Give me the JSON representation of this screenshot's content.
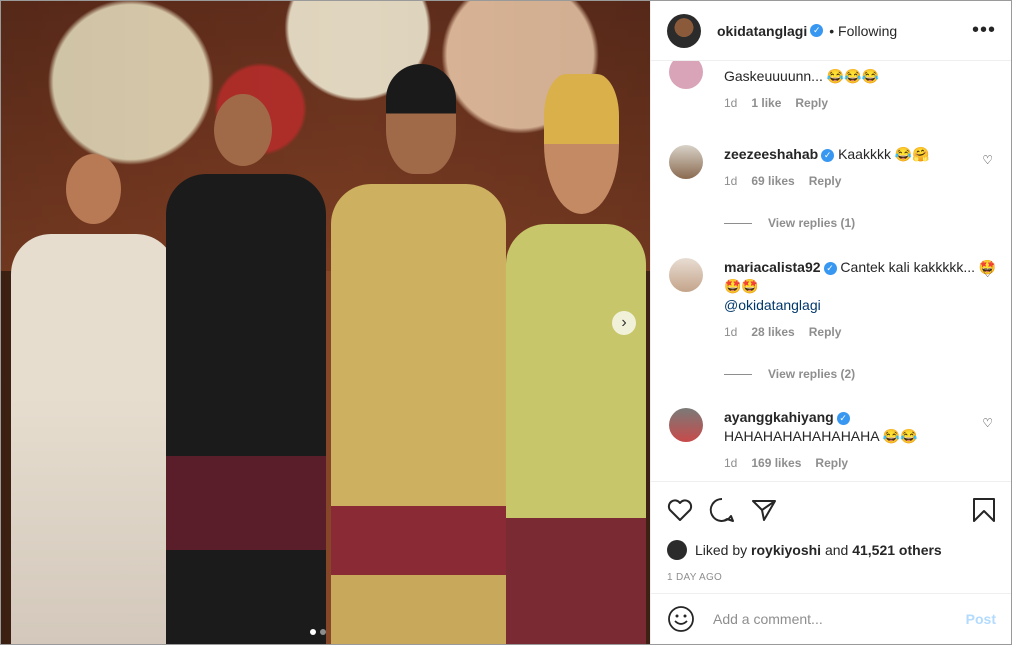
{
  "post": {
    "username": "okidatanglagi",
    "follow_status": "Following",
    "more_label": "•••"
  },
  "comments": [
    {
      "username": "",
      "text": "Gaskeuuuunn... 😂😂😂",
      "time": "1d",
      "likes": "1 like",
      "reply": "Reply"
    },
    {
      "username": "zeezeeshahab",
      "verified": true,
      "text": "Kaakkkk 😂🤗",
      "time": "1d",
      "likes": "69 likes",
      "reply": "Reply",
      "view_replies": "View replies (1)"
    },
    {
      "username": "mariacalista92",
      "verified": true,
      "text": "Cantek kali kakkkkk... 🤩🤩🤩",
      "mention": "@okidatanglagi",
      "time": "1d",
      "likes": "28 likes",
      "reply": "Reply",
      "view_replies": "View replies (2)"
    },
    {
      "username": "ayanggkahiyang",
      "verified": true,
      "text": "HAHAHAHAHAHAHAHA 😂😂",
      "time": "1d",
      "likes": "169 likes",
      "reply": "Reply"
    }
  ],
  "likes": {
    "prefix": "Liked by",
    "user": "roykiyoshi",
    "and": "and",
    "others": "41,521 others"
  },
  "timestamp": "1 DAY AGO",
  "add_comment": {
    "placeholder": "Add a comment...",
    "post_label": "Post"
  },
  "carousel": {
    "current": 1,
    "total": 2
  }
}
